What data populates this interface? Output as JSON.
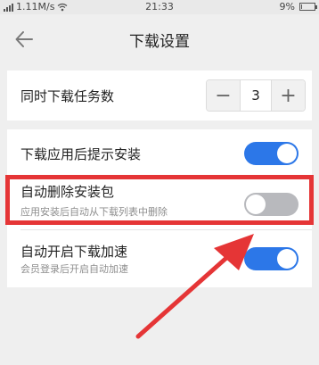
{
  "status_bar": {
    "network_speed": "1.11M/s",
    "time": "21:33",
    "battery_text": "9%",
    "battery_level": 0.09,
    "icons": [
      "signal-icon",
      "wifi-icon",
      "battery-icon"
    ]
  },
  "header": {
    "title": "下载设置",
    "back_icon": "arrow-left-icon"
  },
  "concurrent": {
    "label": "同时下载任务数",
    "value": "3",
    "minus_label": "−",
    "plus_label": "+"
  },
  "settings": [
    {
      "label": "下载应用后提示安装",
      "subtitle": "",
      "enabled": true
    },
    {
      "label": "自动删除安装包",
      "subtitle": "应用安装后自动从下载列表中删除",
      "enabled": false
    },
    {
      "label": "自动开启下载加速",
      "subtitle": "会员登录后开启自动加速",
      "enabled": true
    }
  ],
  "colors": {
    "accent": "#2c77e8",
    "toggle_off": "#b8b9bd",
    "highlight": "#e53536",
    "background": "#efefef"
  }
}
